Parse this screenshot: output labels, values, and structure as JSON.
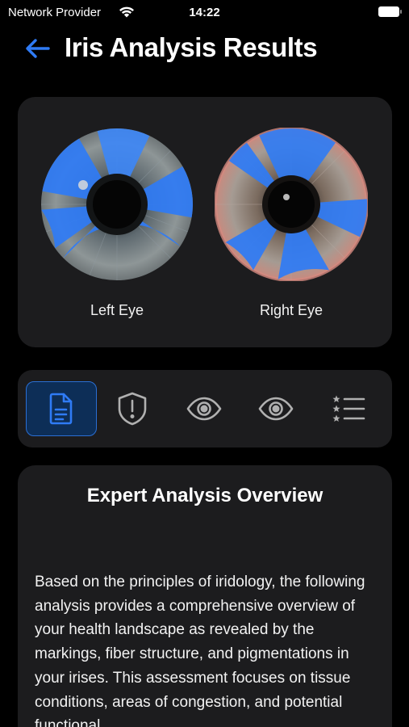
{
  "status_bar": {
    "carrier": "Network Provider",
    "time": "14:22"
  },
  "header": {
    "title": "Iris Analysis Results",
    "back_icon": "arrow-left-icon"
  },
  "eyes": [
    {
      "label": "Left Eye"
    },
    {
      "label": "Right Eye"
    }
  ],
  "tabs": [
    {
      "icon": "document-icon",
      "active": true
    },
    {
      "icon": "shield-alert-icon",
      "active": false
    },
    {
      "icon": "eye-icon",
      "active": false
    },
    {
      "icon": "eye-icon",
      "active": false
    },
    {
      "icon": "star-list-icon",
      "active": false
    }
  ],
  "overview": {
    "title": "Expert Analysis Overview",
    "body": "Based on the principles of iridology, the following analysis provides a comprehensive overview of your health landscape as revealed by the markings, fiber structure, and pigmentations in your irises. This assessment focuses on tissue conditions, areas of congestion, and potential functional"
  },
  "colors": {
    "accent": "#2f7bf5",
    "highlight": "#2f7bf5",
    "card_bg": "#1c1c1e",
    "page_bg": "#000000",
    "active_tab_bg": "#0d2e57"
  }
}
